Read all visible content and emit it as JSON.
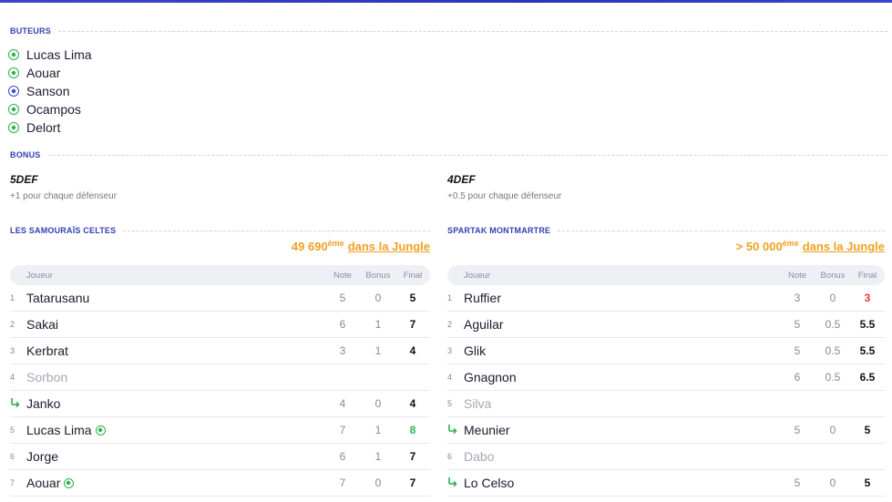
{
  "sections": {
    "scorers_title": "BUTEURS",
    "bonus_title": "BONUS"
  },
  "scorers": [
    {
      "name": "Lucas Lima",
      "color": "#2bb24c"
    },
    {
      "name": "Aouar",
      "color": "#2bb24c"
    },
    {
      "name": "Sanson",
      "color": "#3b46c8"
    },
    {
      "name": "Ocampos",
      "color": "#2bb24c"
    },
    {
      "name": "Delort",
      "color": "#2bb24c"
    }
  ],
  "bonus": {
    "left": {
      "name": "5DEF",
      "desc": "+1 pour chaque défenseur"
    },
    "right": {
      "name": "4DEF",
      "desc": "+0.5 pour chaque défenseur"
    }
  },
  "teams": {
    "left": {
      "name": "LES SAMOURAÏS CELTES",
      "rank_value": "49 690",
      "rank_sup": "ème",
      "rank_link": "dans la Jungle"
    },
    "right": {
      "name": "SPARTAK MONTMARTRE",
      "rank_value": "> 50 000",
      "rank_sup": "ème",
      "rank_link": "dans la Jungle"
    }
  },
  "table_headers": {
    "player": "Joueur",
    "note": "Note",
    "bonus": "Bonus",
    "final": "Final"
  },
  "left_rows": [
    {
      "idx": "1",
      "name": "Tatarusanu",
      "note": "5",
      "bonus": "0",
      "final": "5"
    },
    {
      "idx": "2",
      "name": "Sakai",
      "note": "6",
      "bonus": "1",
      "final": "7"
    },
    {
      "idx": "3",
      "name": "Kerbrat",
      "note": "3",
      "bonus": "1",
      "final": "4"
    },
    {
      "idx": "4",
      "name": "Sorbon",
      "note": "",
      "bonus": "",
      "final": ""
    },
    {
      "idx": "sub",
      "name": "Janko",
      "note": "4",
      "bonus": "0",
      "final": "4"
    },
    {
      "idx": "5",
      "name": "Lucas Lima",
      "note": "7",
      "bonus": "1",
      "final": "8"
    },
    {
      "idx": "6",
      "name": "Jorge",
      "note": "6",
      "bonus": "1",
      "final": "7"
    },
    {
      "idx": "7",
      "name": "Aouar",
      "note": "7",
      "bonus": "0",
      "final": "7"
    }
  ],
  "right_rows": [
    {
      "idx": "1",
      "name": "Ruffier",
      "note": "3",
      "bonus": "0",
      "final": "3"
    },
    {
      "idx": "2",
      "name": "Aguilar",
      "note": "5",
      "bonus": "0.5",
      "final": "5.5"
    },
    {
      "idx": "3",
      "name": "Glik",
      "note": "5",
      "bonus": "0.5",
      "final": "5.5"
    },
    {
      "idx": "4",
      "name": "Gnagnon",
      "note": "6",
      "bonus": "0.5",
      "final": "6.5"
    },
    {
      "idx": "5",
      "name": "Silva",
      "note": "",
      "bonus": "",
      "final": ""
    },
    {
      "idx": "sub",
      "name": "Meunier",
      "note": "5",
      "bonus": "0",
      "final": "5"
    },
    {
      "idx": "6",
      "name": "Dabo",
      "note": "",
      "bonus": "",
      "final": ""
    },
    {
      "idx": "sub",
      "name": "Lo Celso",
      "note": "5",
      "bonus": "0",
      "final": "5"
    }
  ],
  "colors": {
    "accent_blue": "#3340b5",
    "rank_orange": "#f0a020",
    "goal_green": "#2bb24c",
    "sub_green": "#2bb24c",
    "low_red": "#e03c31"
  }
}
